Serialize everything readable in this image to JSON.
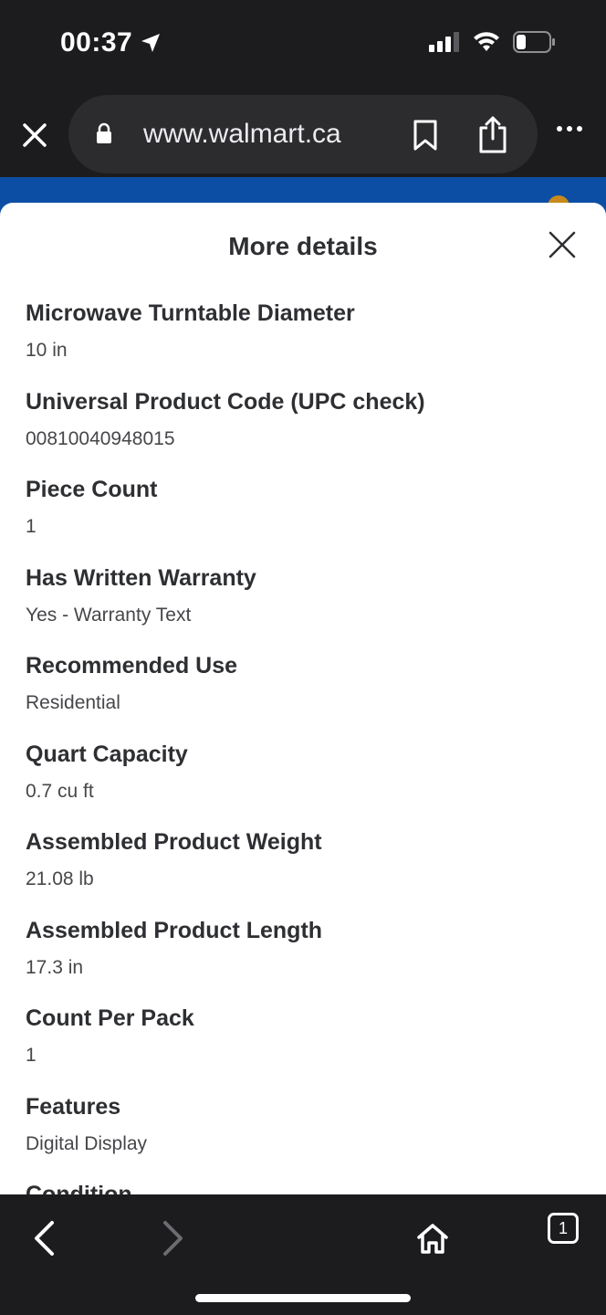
{
  "status_bar": {
    "time": "00:37"
  },
  "browser": {
    "url": "www.walmart.ca"
  },
  "sheet": {
    "title": "More details",
    "details": [
      {
        "label": "Microwave Turntable Diameter",
        "value": "10 in"
      },
      {
        "label": "Universal Product Code (UPC check)",
        "value": "00810040948015"
      },
      {
        "label": "Piece Count",
        "value": "1"
      },
      {
        "label": "Has Written Warranty",
        "value": "Yes - Warranty Text"
      },
      {
        "label": "Recommended Use",
        "value": "Residential"
      },
      {
        "label": "Quart Capacity",
        "value": "0.7 cu ft"
      },
      {
        "label": "Assembled Product Weight",
        "value": "21.08 lb"
      },
      {
        "label": "Assembled Product Length",
        "value": "17.3 in"
      },
      {
        "label": "Count Per Pack",
        "value": "1"
      },
      {
        "label": "Features",
        "value": "Digital Display"
      },
      {
        "label": "Condition",
        "value": ""
      }
    ]
  },
  "toolbar": {
    "tab_count": "1"
  },
  "colors": {
    "walmart_blue": "#0d4ea5",
    "chrome_dark": "#1c1c1e"
  }
}
